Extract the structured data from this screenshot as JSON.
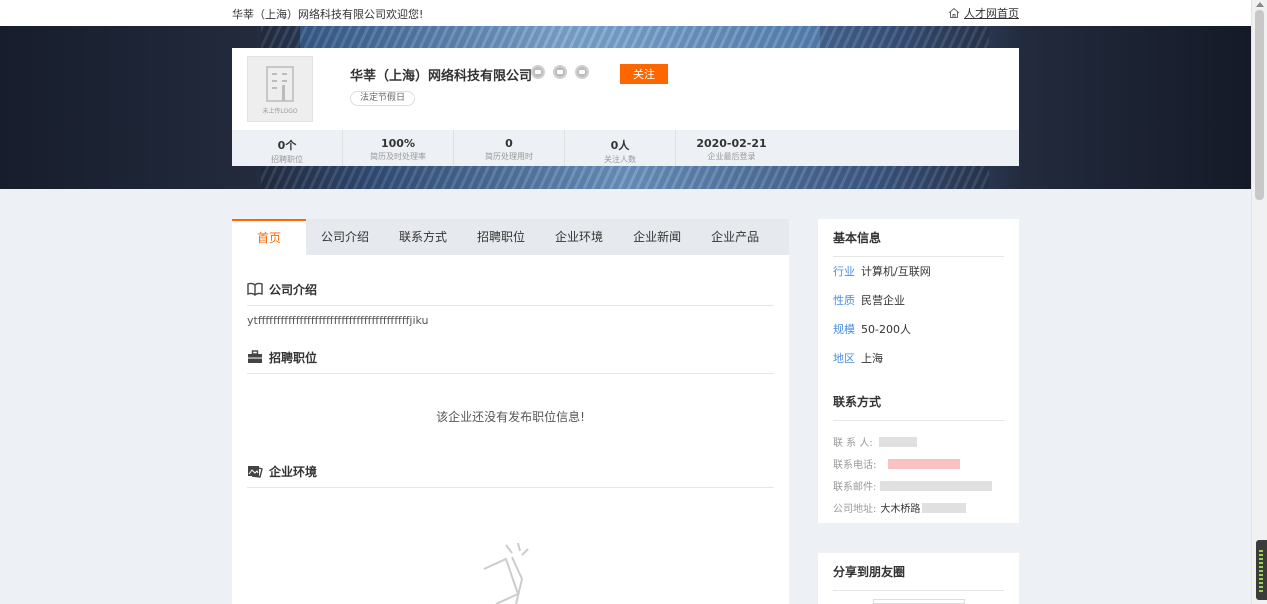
{
  "topbar": {
    "welcome": "华莘（上海）网络科技有限公司欢迎您!",
    "home_link": "人才网首页"
  },
  "company": {
    "name": "华莘（上海）网络科技有限公司",
    "logo_text": "未上传LOGO",
    "follow_label": "关注",
    "tag": "法定节假日"
  },
  "stats": [
    {
      "value": "0个",
      "label": "招聘职位"
    },
    {
      "value": "100%",
      "label": "简历及时处理率"
    },
    {
      "value": "0",
      "label": "简历处理用时"
    },
    {
      "value": "0人",
      "label": "关注人数"
    },
    {
      "value": "2020-02-21",
      "label": "企业最后登录"
    }
  ],
  "tabs": [
    "首页",
    "公司介绍",
    "联系方式",
    "招聘职位",
    "企业环境",
    "企业新闻",
    "企业产品"
  ],
  "sections": {
    "intro_title": "公司介绍",
    "intro_text": "ytffffffffffffffffffffffffffffffffffffffffjiku",
    "jobs_title": "招聘职位",
    "jobs_empty": "该企业还没有发布职位信息!",
    "env_title": "企业环境"
  },
  "basic_info": {
    "title": "基本信息",
    "items": [
      {
        "key": "行业",
        "value": "计算机/互联网"
      },
      {
        "key": "性质",
        "value": "民营企业"
      },
      {
        "key": "规模",
        "value": "50-200人"
      },
      {
        "key": "地区",
        "value": "上海"
      }
    ]
  },
  "contact": {
    "title": "联系方式",
    "person_label": "联 系 人:",
    "phone_label": "联系电话:",
    "email_label": "联系邮件:",
    "address_label": "公司地址:",
    "address_value": "大木桥路"
  },
  "share": {
    "title": "分享到朋友圈"
  },
  "colors": {
    "accent": "#ff6600",
    "link": "#4a8ee0",
    "background": "#edf0f5"
  }
}
